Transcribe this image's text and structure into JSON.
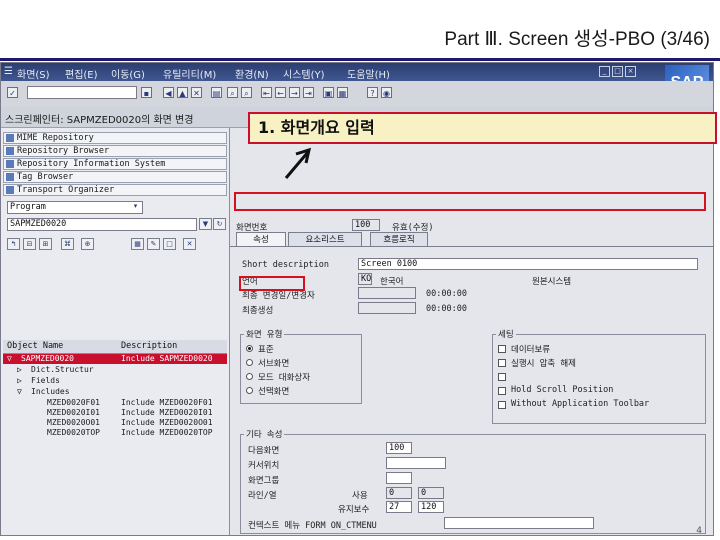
{
  "slide": {
    "title": "Part Ⅲ. Screen 생성-PBO (3/46)",
    "page_number": "4"
  },
  "callout": {
    "text": "1. 화면개요 입력"
  },
  "sap": {
    "menu": [
      "화면(S)",
      "편집(E)",
      "이동(G)",
      "유틸리티(M)",
      "환경(N)",
      "시스템(Y)",
      "도움말(H)"
    ],
    "brand": "SAP",
    "window_title": "스크린페인터: SAPMZED0020의 화면 변경",
    "left": {
      "nav": [
        "MIME Repository",
        "Repository Browser",
        "Repository Information System",
        "Tag Browser",
        "Transport Organizer"
      ],
      "object_type": "Program",
      "object_name": "SAPMZED0020",
      "columns": {
        "name": "Object Name",
        "desc": "Description"
      },
      "tree": [
        {
          "name": "SAPMZED0020",
          "desc": "Include SAPMZED0020"
        },
        {
          "name": "Dict.Structur",
          "desc": ""
        },
        {
          "name": "Fields",
          "desc": ""
        },
        {
          "name": "Includes",
          "desc": ""
        },
        {
          "name": "MZED0020F01",
          "desc": "Include MZED0020F01"
        },
        {
          "name": "MZED0020I01",
          "desc": "Include MZED0020I01"
        },
        {
          "name": "MZED0020O01",
          "desc": "Include MZED0020O01"
        },
        {
          "name": "MZED0020TOP",
          "desc": "Include MZED0020TOP"
        }
      ]
    },
    "right": {
      "screen_no_label": "화면번호",
      "screen_no": "100",
      "status": "유효(수정)",
      "tabs": [
        "속성",
        "요소리스트",
        "흐름로직"
      ],
      "short_desc_label": "Short description",
      "short_desc": "Screen 0100",
      "lang_label": "언어",
      "lang_code": "KO",
      "lang_name": "한국어",
      "original_label": "원본시스템",
      "changed_label": "최종 변경일/변경자",
      "changed_time": "00:00:00",
      "generated_label": "최종생성",
      "generated_time": "00:00:00",
      "type_group": "화면 유형",
      "type_options": [
        "표준",
        "서브화면",
        "모드 대화상자",
        "선택화면"
      ],
      "settings_group": "세팅",
      "settings": [
        "데이터보류",
        "실행시 압축 해제",
        "",
        "Hold Scroll Position",
        "Without Application Toolbar"
      ],
      "other_group": "기타 속성",
      "next_screen_label": "다음화면",
      "next_screen": "100",
      "cursor_label": "커서위치",
      "screen_group_label": "화면그룹",
      "lines_cols_label": "라인/열",
      "used_label": "사용",
      "used_lines": "0",
      "used_cols": "0",
      "maint_label": "유지보수",
      "maint_lines": "27",
      "maint_cols": "120",
      "context_label": "컨텍스트 메뉴 FORM ON_CTMENU"
    }
  }
}
